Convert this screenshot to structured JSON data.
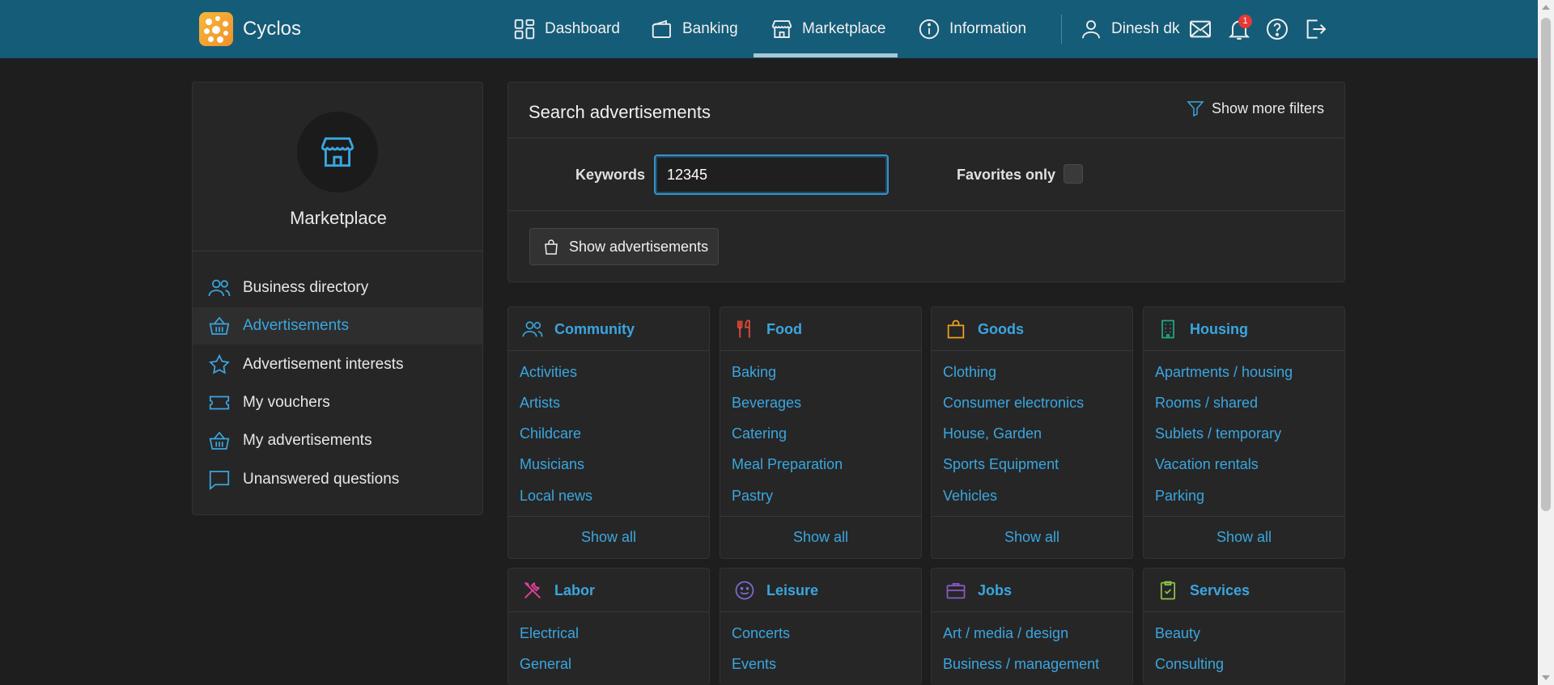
{
  "app": {
    "title": "Cyclos"
  },
  "nav": {
    "dashboard": "Dashboard",
    "banking": "Banking",
    "marketplace": "Marketplace",
    "information": "Information",
    "user": "Dinesh dk",
    "notification_count": "1"
  },
  "sidebar": {
    "title": "Marketplace",
    "items": [
      {
        "label": "Business directory",
        "icon": "users-icon"
      },
      {
        "label": "Advertisements",
        "icon": "basket-icon",
        "active": true
      },
      {
        "label": "Advertisement interests",
        "icon": "star-icon"
      },
      {
        "label": "My vouchers",
        "icon": "ticket-icon"
      },
      {
        "label": "My advertisements",
        "icon": "basket-icon"
      },
      {
        "label": "Unanswered questions",
        "icon": "chat-icon"
      }
    ]
  },
  "search": {
    "title": "Search advertisements",
    "more_filters": "Show more filters",
    "keywords_label": "Keywords",
    "keywords_value": "12345",
    "favorites_label": "Favorites only",
    "show_button": "Show advertisements"
  },
  "categories": [
    {
      "name": "Community",
      "links": [
        "Activities",
        "Artists",
        "Childcare",
        "Musicians",
        "Local news"
      ],
      "show_all": "Show all",
      "color": "#3aa6e0"
    },
    {
      "name": "Food",
      "links": [
        "Baking",
        "Beverages",
        "Catering",
        "Meal Preparation",
        "Pastry"
      ],
      "show_all": "Show all",
      "color": "#e04a3a"
    },
    {
      "name": "Goods",
      "links": [
        "Clothing",
        "Consumer electronics",
        "House, Garden",
        "Sports Equipment",
        "Vehicles"
      ],
      "show_all": "Show all",
      "color": "#f0a020"
    },
    {
      "name": "Housing",
      "links": [
        "Apartments / housing",
        "Rooms / shared",
        "Sublets / temporary",
        "Vacation rentals",
        "Parking"
      ],
      "show_all": "Show all",
      "color": "#1fa88a"
    },
    {
      "name": "Labor",
      "links": [
        "Electrical",
        "General"
      ],
      "color": "#e0409a"
    },
    {
      "name": "Leisure",
      "links": [
        "Concerts",
        "Events"
      ],
      "color": "#7d6ad0"
    },
    {
      "name": "Jobs",
      "links": [
        "Art / media / design",
        "Business / management"
      ],
      "color": "#8a5ac8"
    },
    {
      "name": "Services",
      "links": [
        "Beauty",
        "Consulting"
      ],
      "color": "#8bc34a"
    }
  ]
}
